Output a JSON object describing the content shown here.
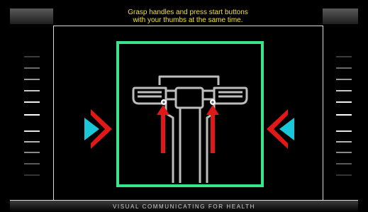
{
  "instruction": {
    "text": "Grasp handles and press start buttons\nwith your thumbs at the same time."
  },
  "footer": {
    "text": "VISUAL COMMUNICATING FOR HEALTH"
  },
  "colors": {
    "instruction": "#f2e030",
    "frame": "#39e58a",
    "arrow": "#e01818",
    "chevron_inner": "#19c7d8",
    "chevron_outer": "#e01818",
    "handle": "#bdbdbd"
  },
  "icons": [
    "handlebar-icon",
    "arrow-up-icon",
    "chevron-right-icon",
    "chevron-left-icon",
    "level-indicator"
  ]
}
